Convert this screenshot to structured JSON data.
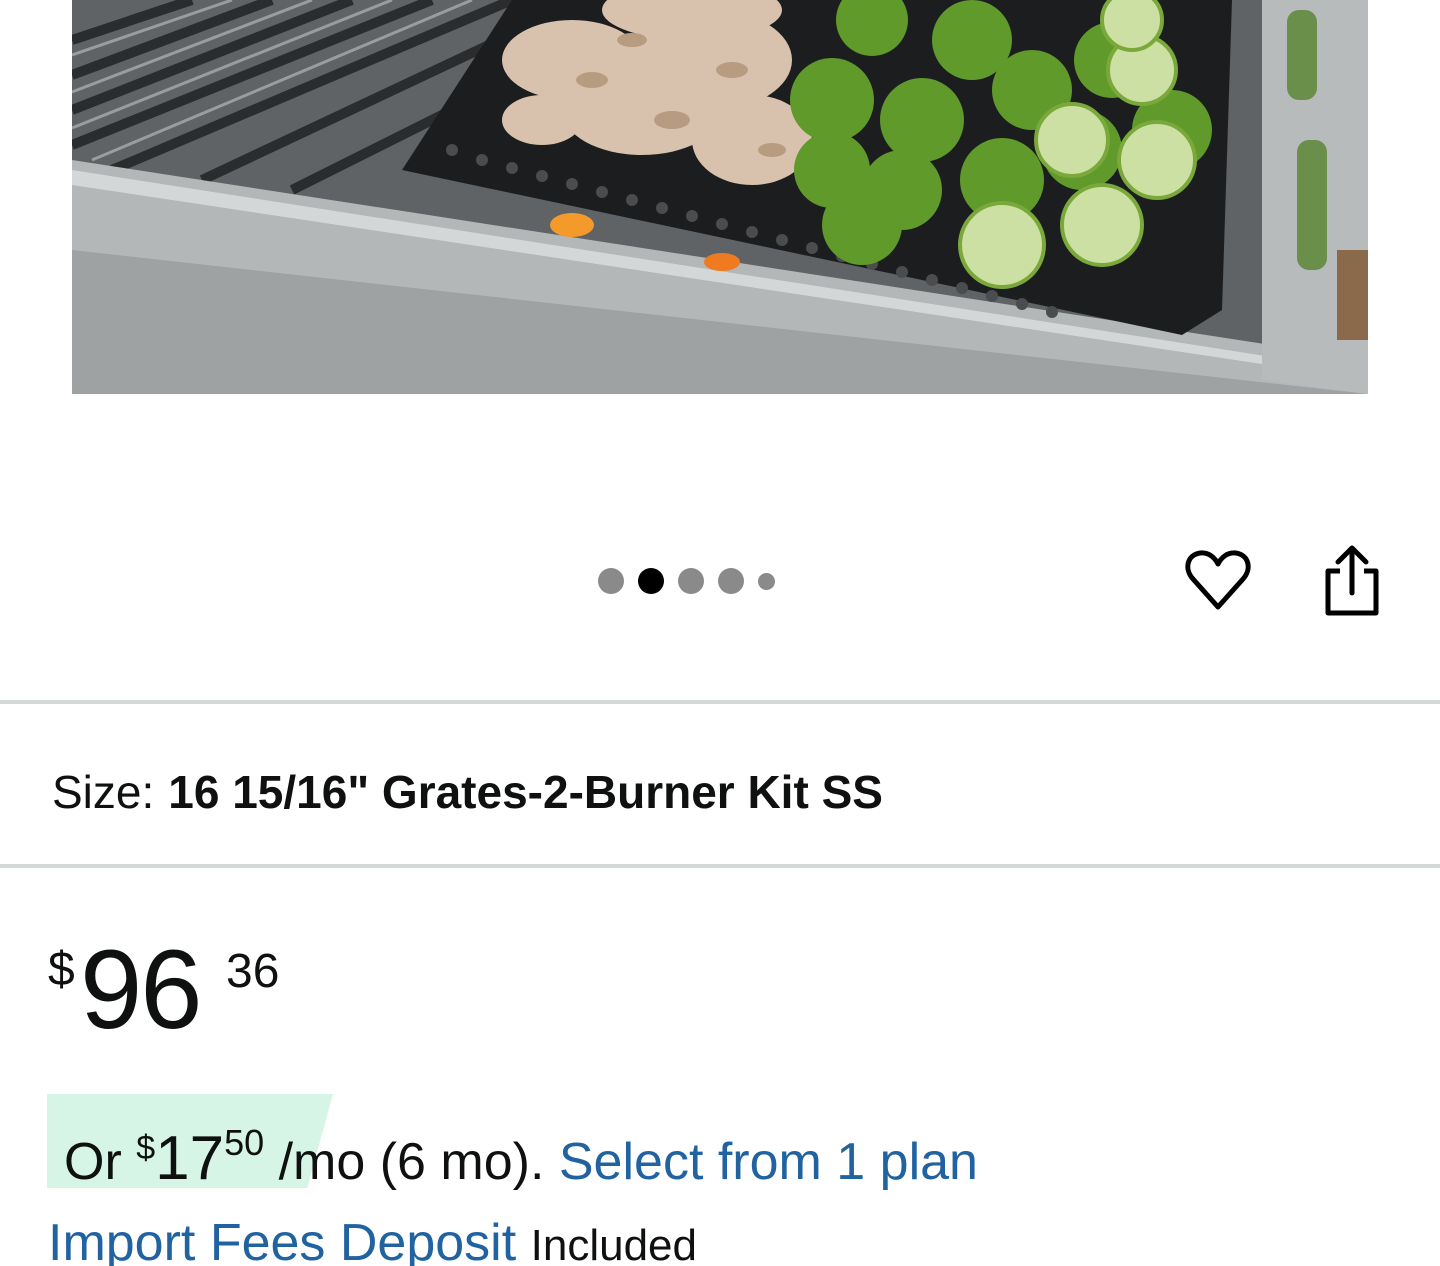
{
  "image_carousel": {
    "image_alt": "Grill topper with mushrooms and brussels sprouts on a gas grill",
    "dot_count": 5,
    "active_index": 1
  },
  "actions": {
    "wishlist_icon": "heart-outline-icon",
    "share_icon": "share-icon"
  },
  "size": {
    "label": "Size:",
    "value": "16 15/16\" Grates-2-Burner Kit SS"
  },
  "price": {
    "symbol": "$",
    "whole": "96",
    "fraction": "36"
  },
  "installment": {
    "prefix": "Or ",
    "symbol": "$",
    "whole": "17",
    "fraction": "50",
    "suffix": " /mo (6 mo).",
    "link": "Select from 1 plan",
    "highlight_color": "#d7f5e6"
  },
  "import_fees": {
    "link": "Import Fees Deposit",
    "status": "Included"
  },
  "colors": {
    "link": "#2162a1",
    "divider": "#d5d9d9"
  }
}
